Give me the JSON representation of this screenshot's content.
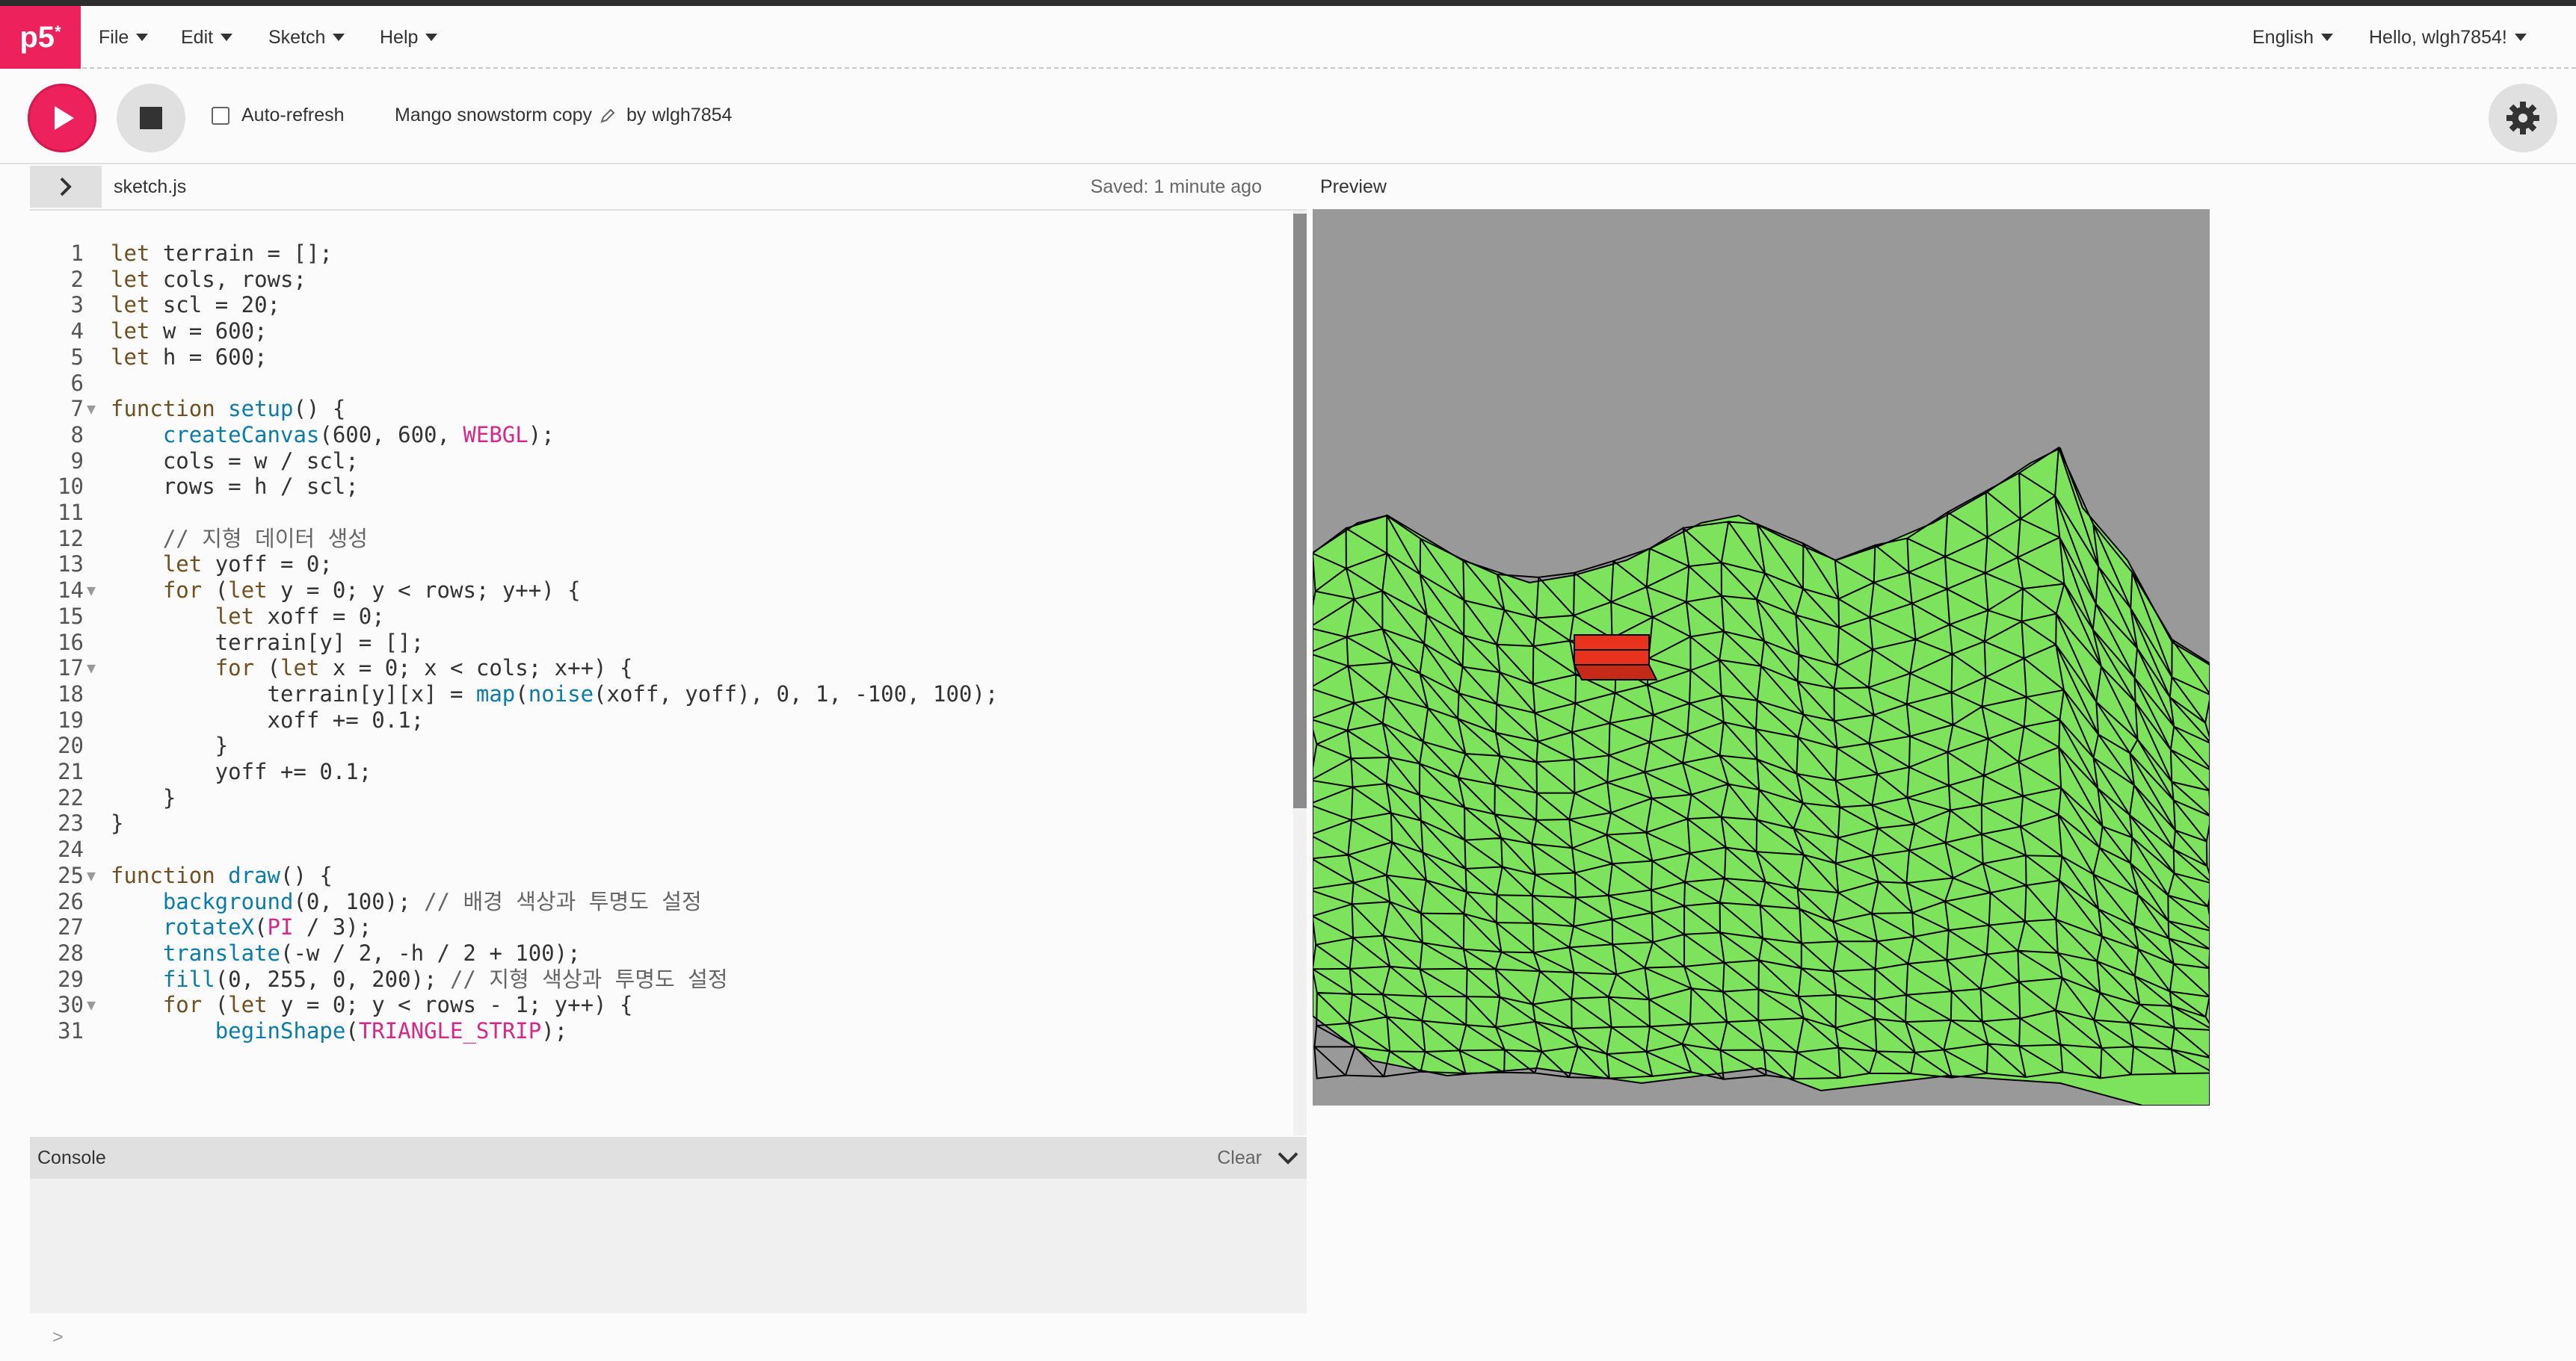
{
  "nav": {
    "logo": "p5",
    "logo_sup": "*",
    "menus": [
      "File",
      "Edit",
      "Sketch",
      "Help"
    ],
    "language": "English",
    "user_greeting": "Hello, wlgh7854!"
  },
  "toolbar": {
    "auto_refresh_label": "Auto-refresh",
    "sketch_name": "Mango snowstorm copy",
    "by_label": "by",
    "owner": "wlgh7854"
  },
  "editor": {
    "filename": "sketch.js",
    "saved_status": "Saved: 1 minute ago",
    "lines": [
      "let terrain = [];",
      "let cols, rows;",
      "let scl = 20;",
      "let w = 600;",
      "let h = 600;",
      "",
      "function setup() {",
      "    createCanvas(600, 600, WEBGL);",
      "    cols = w / scl;",
      "    rows = h / scl;",
      "",
      "    // 지형 데이터 생성",
      "    let yoff = 0;",
      "    for (let y = 0; y < rows; y++) {",
      "        let xoff = 0;",
      "        terrain[y] = [];",
      "        for (let x = 0; x < cols; x++) {",
      "            terrain[y][x] = map(noise(xoff, yoff), 0, 1, -100, 100);",
      "            xoff += 0.1;",
      "        }",
      "        yoff += 0.1;",
      "    }",
      "}",
      "",
      "function draw() {",
      "    background(0, 100); // 배경 색상과 투명도 설정",
      "    rotateX(PI / 3);",
      "    translate(-w / 2, -h / 2 + 100);",
      "    fill(0, 255, 0, 200); // 지형 색상과 투명도 설정",
      "    for (let y = 0; y < rows - 1; y++) {",
      "        beginShape(TRIANGLE_STRIP);"
    ],
    "fold_lines": [
      7,
      14,
      17,
      25,
      30
    ]
  },
  "preview": {
    "label": "Preview"
  },
  "console": {
    "title": "Console",
    "clear_label": "Clear",
    "prompt": ">"
  },
  "colors": {
    "accent": "#ed225d",
    "terrain": "#7de35c",
    "box": "#e8321e",
    "sky": "#999999"
  },
  "icons": [
    "play-icon",
    "stop-icon",
    "gear-icon",
    "pencil-icon",
    "chevron-right-icon",
    "chevron-down-icon"
  ]
}
